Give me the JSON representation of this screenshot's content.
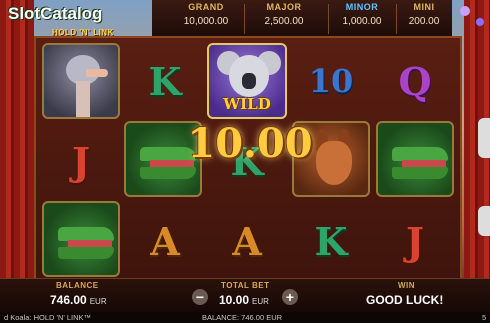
{
  "logo": {
    "main": "SlotCatalog",
    "sub": "HOLD 'N' LINK"
  },
  "jackpots": [
    {
      "name": "GRAND",
      "value": "10,000.00",
      "color": "#e0b85a"
    },
    {
      "name": "MAJOR",
      "value": "2,500.00",
      "color": "#e0b85a"
    },
    {
      "name": "MINOR",
      "value": "1,000.00",
      "color": "#5ec8ff"
    },
    {
      "name": "MINI",
      "value": "200.00",
      "color": "#e0b85a"
    }
  ],
  "reels": {
    "row1": [
      "ostrich",
      "K",
      "koala-wild",
      "10",
      "Q"
    ],
    "row2": [
      "J",
      "crocodile",
      "K",
      "kangaroo",
      "crocodile"
    ],
    "row3": [
      "crocodile",
      "A",
      "A",
      "K",
      "J"
    ],
    "wild_label": "WILD"
  },
  "win_amount": "10.00",
  "bottom": {
    "balance_label": "BALANCE",
    "balance_value": "746.00",
    "balance_unit": "EUR",
    "bet_label": "TOTAL BET",
    "bet_value": "10.00",
    "bet_unit": "EUR",
    "minus": "−",
    "plus": "+",
    "win_label": "WIN",
    "win_value": "GOOD LUCK!"
  },
  "status": {
    "title": "d Koala: HOLD 'N' LINK™",
    "balance": "BALANCE: 746.00 EUR",
    "right": "5"
  }
}
